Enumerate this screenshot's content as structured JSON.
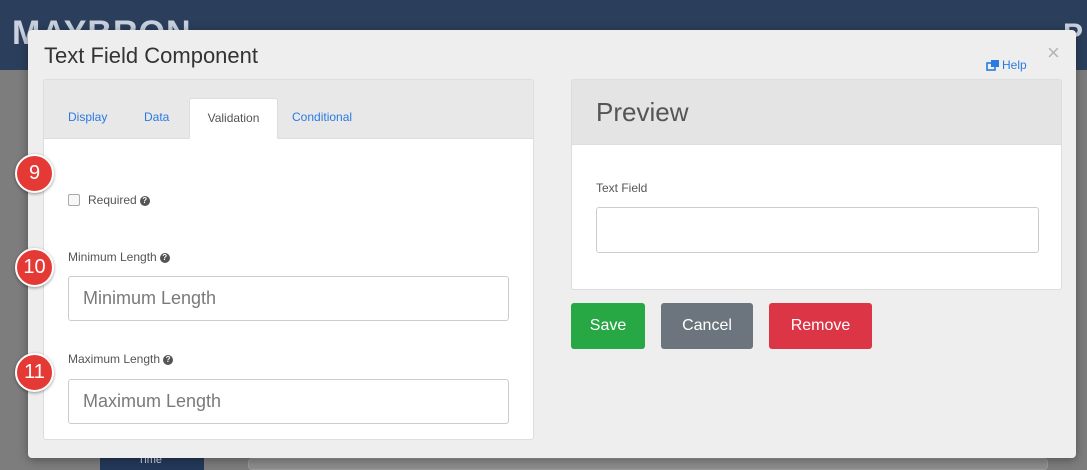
{
  "background": {
    "brand": "MAYBRON",
    "corner_glyph": "P",
    "sidebar_item": "Time"
  },
  "dialog": {
    "title": "Text Field Component",
    "close_glyph": "×",
    "help_label": "Help",
    "tabs": [
      {
        "label": "Display",
        "active": false
      },
      {
        "label": "Data",
        "active": false
      },
      {
        "label": "Validation",
        "active": true
      },
      {
        "label": "Conditional",
        "active": false
      }
    ],
    "validation": {
      "required_label": "Required",
      "required_checked": false,
      "min_length_label": "Minimum Length",
      "min_length_placeholder": "Minimum Length",
      "min_length_value": "",
      "max_length_label": "Maximum Length",
      "max_length_placeholder": "Maximum Length",
      "max_length_value": ""
    },
    "preview": {
      "title": "Preview",
      "field_label": "Text Field",
      "field_value": ""
    },
    "buttons": {
      "save": "Save",
      "cancel": "Cancel",
      "remove": "Remove"
    }
  },
  "callouts": [
    "9",
    "10",
    "11"
  ],
  "colors": {
    "save": "#28a745",
    "cancel": "#6c757d",
    "remove": "#dc3545",
    "link": "#2a7ae2",
    "callout": "#e53935"
  }
}
